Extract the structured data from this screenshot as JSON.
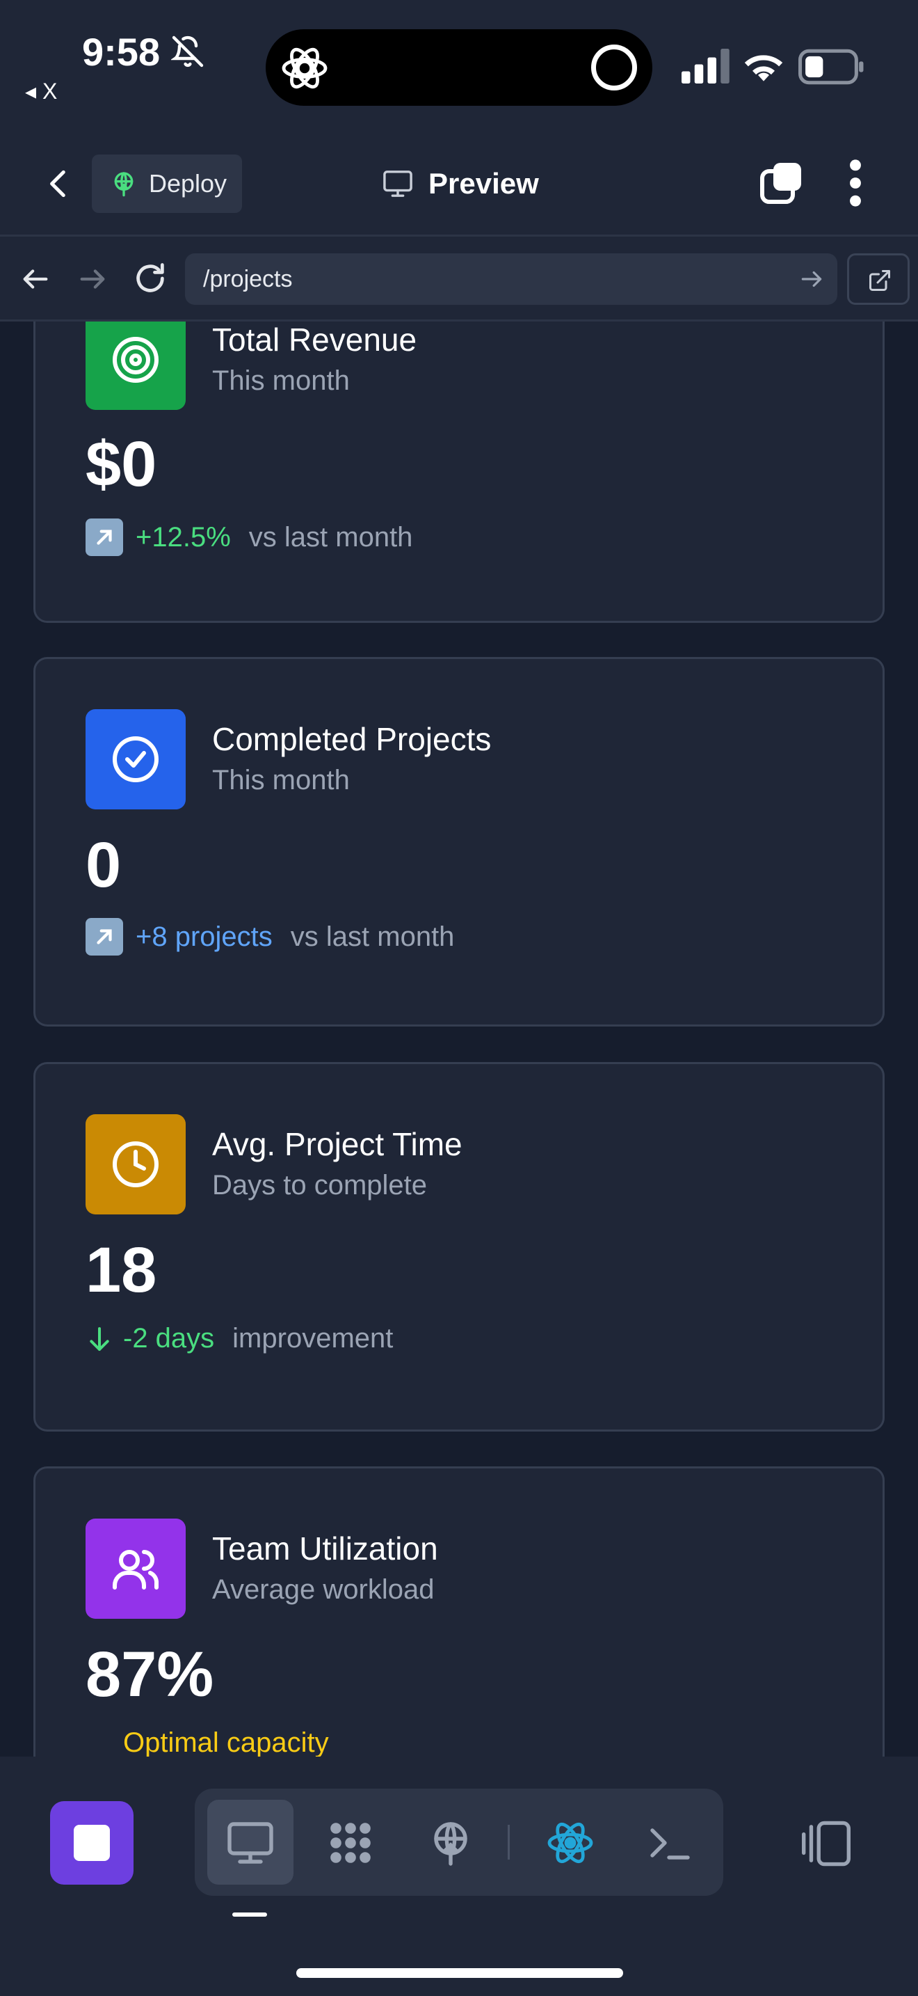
{
  "status_bar": {
    "time": "9:58",
    "back_app": "◂ X",
    "icons": [
      "bell-off-icon",
      "chatgpt-logo-icon",
      "activity-ring-icon",
      "cellular-signal-icon",
      "wifi-icon",
      "battery-icon"
    ]
  },
  "header": {
    "deploy_label": "Deploy",
    "preview_label": "Preview",
    "icons": [
      "back-chevron-icon",
      "deploy-icon",
      "monitor-icon",
      "tabs-icon",
      "more-vertical-icon"
    ]
  },
  "url_bar": {
    "url": "/projects",
    "icons": [
      "back-arrow-icon",
      "forward-arrow-icon",
      "reload-icon",
      "go-arrow-icon",
      "open-external-icon"
    ]
  },
  "cards": [
    {
      "title": "Total Revenue",
      "subtitle": "This month",
      "value": "$0",
      "change": "+12.5%",
      "comparison": "vs last month",
      "icon": "target-icon",
      "icon_bg": "#16a34a",
      "change_color": "#4ade80"
    },
    {
      "title": "Completed Projects",
      "subtitle": "This month",
      "value": "0",
      "change": "+8 projects",
      "comparison": "vs last month",
      "icon": "check-circle-icon",
      "icon_bg": "#2563eb",
      "change_color": "#60a5fa"
    },
    {
      "title": "Avg. Project Time",
      "subtitle": "Days to complete",
      "value": "18",
      "change": "-2 days",
      "comparison": "improvement",
      "icon": "clock-icon",
      "icon_bg": "#ca8a04",
      "change_color": "#4ade80"
    },
    {
      "title": "Team Utilization",
      "subtitle": "Average workload",
      "value": "87%",
      "change": "Optimal capacity",
      "icon": "users-icon",
      "icon_bg": "#9333ea",
      "change_color": "#facc15"
    }
  ],
  "bottom_bar": {
    "icons": [
      "stop-icon",
      "desktop-preview-icon",
      "database-icon",
      "deploy-icon",
      "react-icon",
      "terminal-icon",
      "panel-toggle-icon"
    ]
  },
  "colors": {
    "background": "#161d2d",
    "surface": "#1f2637",
    "accent": "#6d3fe0"
  }
}
